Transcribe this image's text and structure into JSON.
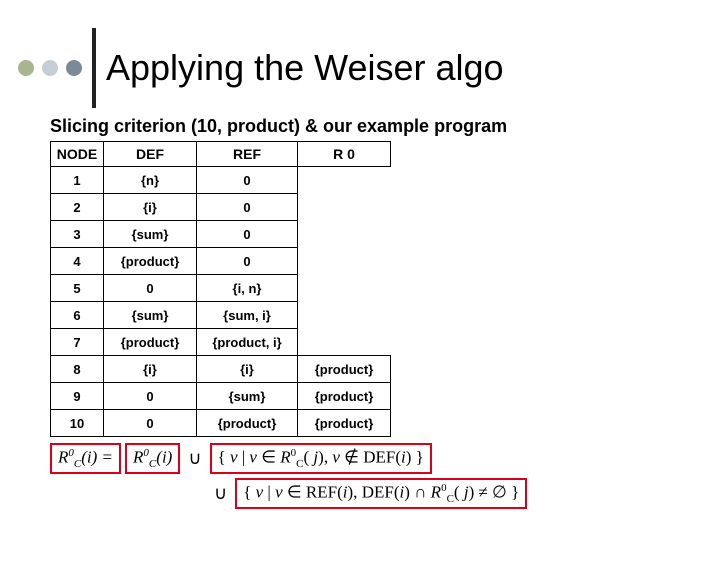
{
  "title": "Applying the Weiser algo",
  "subtitle": "Slicing criterion (10, product) & our example program",
  "headers": {
    "node": "NODE",
    "def": "DEF",
    "ref": "REF",
    "r0": "R 0"
  },
  "rows": [
    {
      "node": "1",
      "def": "{n}",
      "ref": "0",
      "r0": ""
    },
    {
      "node": "2",
      "def": "{i}",
      "ref": "0",
      "r0": ""
    },
    {
      "node": "3",
      "def": "{sum}",
      "ref": "0",
      "r0": ""
    },
    {
      "node": "4",
      "def": "{product}",
      "ref": "0",
      "r0": ""
    },
    {
      "node": "5",
      "def": "0",
      "ref": "{i, n}",
      "r0": ""
    },
    {
      "node": "6",
      "def": "{sum}",
      "ref": "{sum, i}",
      "r0": ""
    },
    {
      "node": "7",
      "def": "{product}",
      "ref": "{product, i}",
      "r0": ""
    },
    {
      "node": "8",
      "def": "{i}",
      "ref": "{i}",
      "r0": "{product}"
    },
    {
      "node": "9",
      "def": "0",
      "ref": "{sum}",
      "r0": "{product}"
    },
    {
      "node": "10",
      "def": "0",
      "ref": "{product}",
      "r0": "{product}"
    }
  ],
  "eq": {
    "lhs": "R⁰_C(i) =",
    "box1": "R⁰_C(i)",
    "box2_pre": "{ v | v ∈ R⁰_C( j), v ∉ ",
    "box2_def": "DEF",
    "box2_post": "(i) }",
    "box3_pre": "{ v | v ∈ ",
    "box3_ref": "REF",
    "box3_mid": "(i), ",
    "box3_def": "DEF",
    "box3_mid2": "(i) ∩ R⁰_C( j) ≠ ∅ }",
    "union": "∪"
  },
  "chart_data": {
    "type": "table",
    "title": "DEF/REF sets and initial relevant variables R0 per node",
    "columns": [
      "NODE",
      "DEF",
      "REF",
      "R0"
    ],
    "rows": [
      [
        1,
        "{n}",
        "∅",
        ""
      ],
      [
        2,
        "{i}",
        "∅",
        ""
      ],
      [
        3,
        "{sum}",
        "∅",
        ""
      ],
      [
        4,
        "{product}",
        "∅",
        ""
      ],
      [
        5,
        "∅",
        "{i, n}",
        ""
      ],
      [
        6,
        "{sum}",
        "{sum, i}",
        ""
      ],
      [
        7,
        "{product}",
        "{product, i}",
        ""
      ],
      [
        8,
        "{i}",
        "{i}",
        "{product}"
      ],
      [
        9,
        "∅",
        "{sum}",
        "{product}"
      ],
      [
        10,
        "∅",
        "{product}",
        "{product}"
      ]
    ]
  }
}
